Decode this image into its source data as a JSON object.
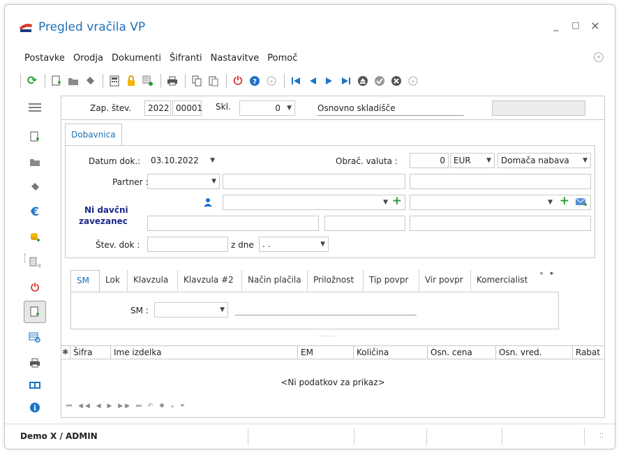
{
  "window": {
    "title": "Pregled vračila VP",
    "controls": {
      "minimize": "_",
      "maximize": "□",
      "close": "×"
    }
  },
  "menu": {
    "items": [
      "Postavke",
      "Orodja",
      "Dokumenti",
      "Šifranti",
      "Nastavitve",
      "Pomoč"
    ]
  },
  "header": {
    "zap_label": "Zap. štev.",
    "zap_year": "2022",
    "zap_number": "00001",
    "skl_label": "Skl.",
    "skl_value": "0",
    "skl_name": "Osnovno skladišče"
  },
  "main_tab": {
    "label": "Dobavnica"
  },
  "form": {
    "datum_label": "Datum dok.:",
    "datum_value": "03.10.2022",
    "valuta_label": "Obrač. valuta :",
    "valuta_amount": "0",
    "valuta_currency": "EUR",
    "nabava_value": "Domača nabava",
    "partner_label": "Partner :",
    "ni_davcni_1": "Ni davčni",
    "ni_davcni_2": "zavezanec",
    "stev_dok_label": "Štev. dok :",
    "z_dne_label": "z dne",
    "z_dne_value": ". ."
  },
  "sub_tabs": [
    "SM",
    "Lok",
    "Klavzula",
    "Klavzula #2",
    "Način plačila",
    "Priložnost",
    "Tip povpr",
    "Vir povpr",
    "Komercialist"
  ],
  "sm_panel": {
    "label": "SM :"
  },
  "grid": {
    "columns": [
      "Šifra",
      "Ime izdelka",
      "EM",
      "Količina",
      "Osn. cena",
      "Osn. vred.",
      "Rabat"
    ],
    "empty_text": "<Ni podatkov za prikaz>",
    "splitter": "......."
  },
  "status": {
    "user": "Demo X / ADMIN"
  },
  "colors": {
    "accent": "#1f6fb5",
    "green": "#2e9e3a",
    "red": "#d9342b",
    "blue": "#1e73c8",
    "navy": "#1a2a8a"
  }
}
